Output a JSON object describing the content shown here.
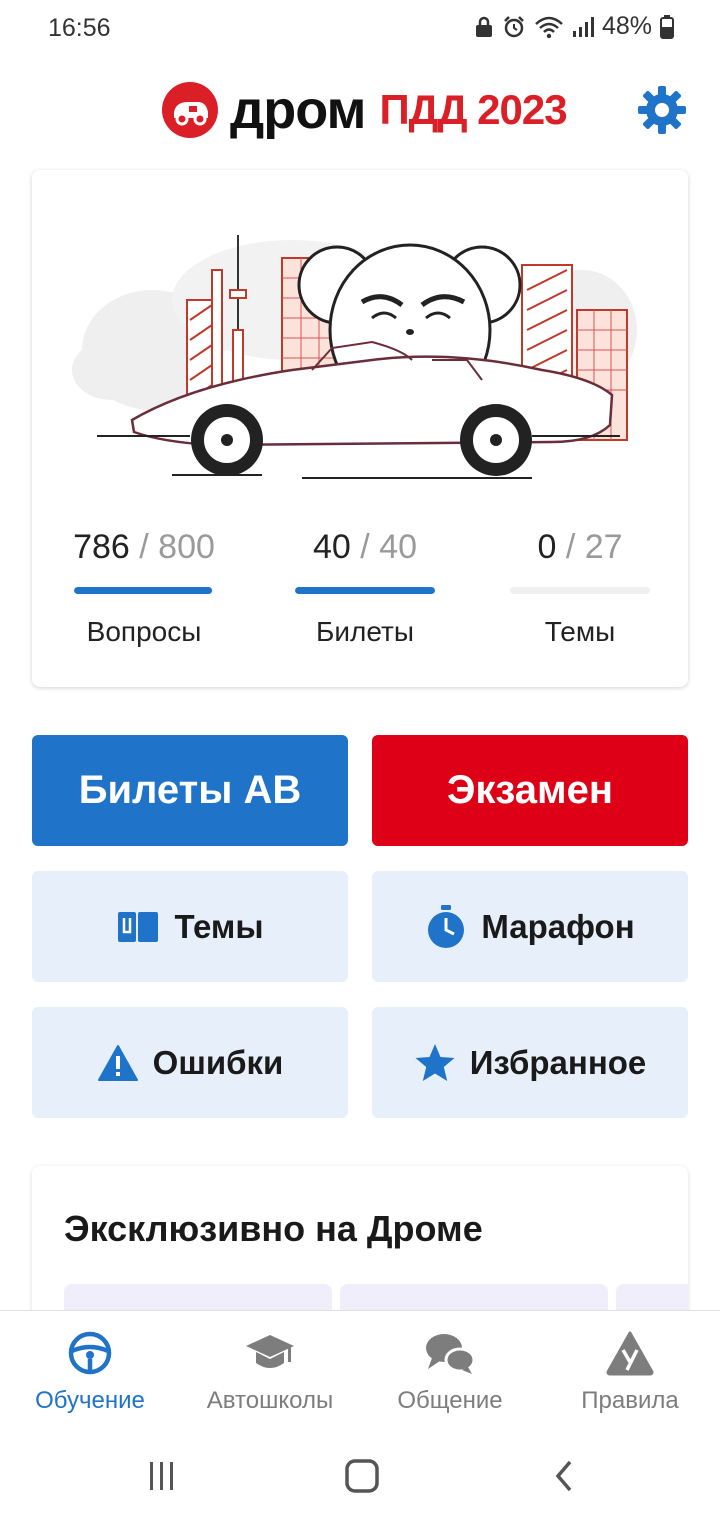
{
  "status_bar": {
    "time": "16:56",
    "battery": "48%"
  },
  "header": {
    "logo_word": "дром",
    "logo_sub": "ПДД 2023"
  },
  "stats": [
    {
      "done": "786",
      "total": "800",
      "label": "Вопросы",
      "progress": 0.9825
    },
    {
      "done": "40",
      "total": "40",
      "label": "Билеты",
      "progress": 1.0
    },
    {
      "done": "0",
      "total": "27",
      "label": "Темы",
      "progress": 0.0
    }
  ],
  "stat_separator": "/",
  "buttons": {
    "tickets": "Билеты АВ",
    "exam": "Экзамен",
    "topics": "Темы",
    "marathon": "Марафон",
    "mistakes": "Ошибки",
    "favorites": "Избранное"
  },
  "exclusive": {
    "title": "Эксклюзивно на Дроме"
  },
  "bottom_nav": [
    {
      "label": "Обучение",
      "icon": "steering-wheel-icon",
      "active": true
    },
    {
      "label": "Автошколы",
      "icon": "graduation-cap-icon",
      "active": false
    },
    {
      "label": "Общение",
      "icon": "chat-bubbles-icon",
      "active": false
    },
    {
      "label": "Правила",
      "icon": "warning-sign-icon",
      "active": false
    }
  ],
  "colors": {
    "accent": "#1f73c8",
    "brand": "#db1f26",
    "exam": "#de0016",
    "light_button": "#e7f0fa"
  }
}
